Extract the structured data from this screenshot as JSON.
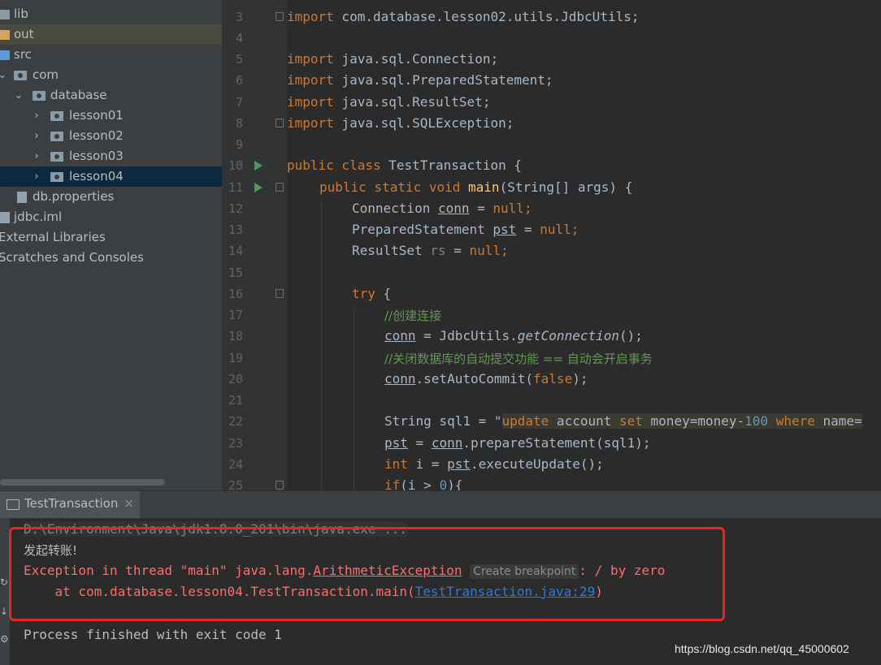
{
  "project_tree": {
    "items": [
      {
        "label": "lib"
      },
      {
        "label": "out"
      },
      {
        "label": "src"
      },
      {
        "label": "com"
      },
      {
        "label": "database"
      },
      {
        "label": "lesson01"
      },
      {
        "label": "lesson02"
      },
      {
        "label": "lesson03"
      },
      {
        "label": "lesson04"
      },
      {
        "label": "db.properties"
      },
      {
        "label": "jdbc.iml"
      },
      {
        "label": "External Libraries"
      },
      {
        "label": "Scratches and Consoles"
      }
    ]
  },
  "editor": {
    "line_numbers": [
      "3",
      "4",
      "5",
      "6",
      "7",
      "8",
      "9",
      "10",
      "11",
      "12",
      "13",
      "14",
      "15",
      "16",
      "17",
      "18",
      "19",
      "20",
      "21",
      "22",
      "23",
      "24",
      "25"
    ],
    "lines": {
      "l3_kw": "import",
      "l3_rest": " com.database.lesson02.utils.JdbcUtils;",
      "l5_kw": "import",
      "l5_rest": " java.sql.Connection;",
      "l6_kw": "import",
      "l6_rest": " java.sql.PreparedStatement;",
      "l7_kw": "import",
      "l7_rest": " java.sql.ResultSet;",
      "l8_kw": "import",
      "l8_rest": " java.sql.SQLException;",
      "l10_kw": "public class",
      "l10_rest": " TestTransaction {",
      "l11_kw": "public static void",
      "l11_fn": "main",
      "l11_rest": "(String[] args) {",
      "l12_a": "Connection ",
      "l12_var": "conn",
      "l12_b": " = ",
      "l12_kw": "null",
      "l12_c": ";",
      "l13_a": "PreparedStatement ",
      "l13_var": "pst",
      "l13_b": " = ",
      "l13_kw": "null",
      "l13_c": ";",
      "l14_a": "ResultSet ",
      "l14_var": "rs",
      "l14_b": " = ",
      "l14_kw": "null",
      "l14_c": ";",
      "l16_kw": "try",
      "l16_rest": " {",
      "l17_cm": "//创建连接",
      "l18_var": "conn",
      "l18_a": " = JdbcUtils.",
      "l18_it": "getConnection",
      "l18_b": "();",
      "l19_cm": "//关闭数据库的自动提交功能 == 自动会开启事务",
      "l20_var": "conn",
      "l20_a": ".setAutoCommit(",
      "l20_kw": "false",
      "l20_b": ");",
      "l22_a": "String sql1 = \"",
      "l22_s1": "update",
      "l22_s2": " account ",
      "l22_s3": "set",
      "l22_s4": " money=money-",
      "l22_num": "100",
      "l22_s5": " ",
      "l22_s6": "where",
      "l22_s7": " name=",
      "l23_var": "pst",
      "l23_a": " = ",
      "l23_var2": "conn",
      "l23_b": ".prepareStatement(sql1);",
      "l24_kw": "int",
      "l24_a": " i = ",
      "l24_var": "pst",
      "l24_b": ".executeUpdate();",
      "l25_kw": "if",
      "l25_a": "(i > ",
      "l25_num": "0",
      "l25_b": "){"
    }
  },
  "run_panel": {
    "tab_label": "TestTransaction",
    "tab_close": "×",
    "command_line": "D:\\Environment\\Java\\jdk1.8.0_201\\bin\\java.exe ...",
    "line_transfer": "发起转账!",
    "exception_prefix": "Exception in thread \"main\" java.lang.",
    "exception_class": "ArithmeticException",
    "breakpoint_hint": "Create breakpoint",
    "exception_suffix": ": / by zero",
    "stack_prefix": "    at com.database.lesson04.TestTransaction.main(",
    "stack_link": "TestTransaction.java:29",
    "stack_suffix": ")",
    "process_finished": "Process finished with exit code 1"
  },
  "watermark": "https://blog.csdn.net/qq_45000602",
  "colors": {
    "keyword": "#cc7832",
    "function": "#ffc66d",
    "comment": "#629755",
    "number": "#6897bb",
    "error": "#ff6b68",
    "link": "#287bde",
    "annotation_box": "#e82424"
  }
}
